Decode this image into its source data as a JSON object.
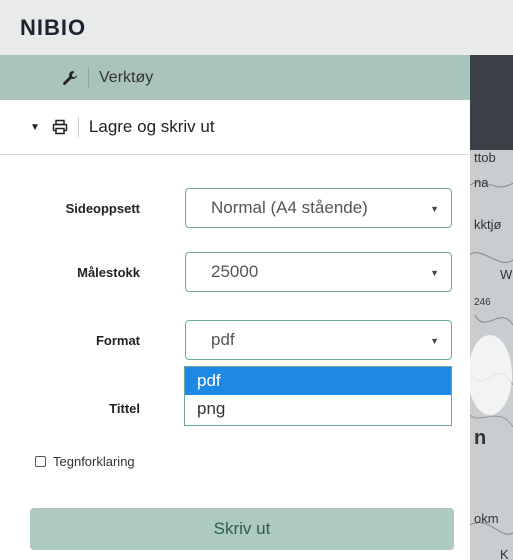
{
  "header": {
    "logo": "NIBIO"
  },
  "tools": {
    "label": "Verktøy",
    "icon": "wrench-icon"
  },
  "section": {
    "label": "Lagre og skriv ut",
    "toggle_icon": "caret-down-icon",
    "icon": "printer-icon"
  },
  "form": {
    "layout": {
      "label": "Sideoppsett",
      "value": "Normal (A4 stående)"
    },
    "scale": {
      "label": "Målestokk",
      "value": "25000"
    },
    "format": {
      "label": "Format",
      "value": "pdf",
      "options": [
        "pdf",
        "png"
      ],
      "selected_option": "pdf"
    },
    "title": {
      "label": "Tittel"
    },
    "legend": {
      "label": "Tegnforklaring",
      "checked": false
    }
  },
  "print_button": {
    "label": "Skriv ut"
  },
  "map": {
    "texts": [
      "ttob",
      "na",
      "kktjø",
      "W",
      "246",
      "n",
      "okm",
      "K"
    ]
  },
  "colors": {
    "accent": "#a9c4bd",
    "selected": "#1e88e5",
    "field_border": "#6aa89a"
  }
}
